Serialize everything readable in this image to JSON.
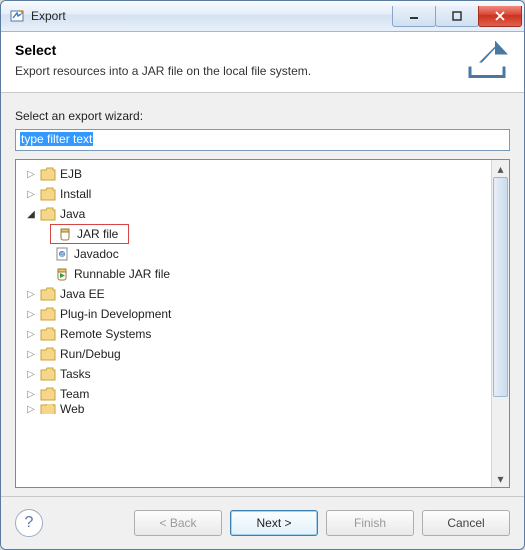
{
  "window": {
    "title": "Export"
  },
  "header": {
    "heading": "Select",
    "description": "Export resources into a JAR file on the local file system."
  },
  "body": {
    "label": "Select an export wizard:",
    "filter_placeholder": "type filter text",
    "filter_value": "type filter text"
  },
  "tree": {
    "nodes": [
      {
        "type": "folder",
        "state": "collapsed",
        "label": "EJB",
        "depth": 1
      },
      {
        "type": "folder",
        "state": "collapsed",
        "label": "Install",
        "depth": 1
      },
      {
        "type": "folder",
        "state": "expanded",
        "label": "Java",
        "depth": 1
      },
      {
        "type": "item",
        "icon": "jar",
        "label": "JAR file",
        "depth": 2,
        "highlighted": true
      },
      {
        "type": "item",
        "icon": "javadoc",
        "label": "Javadoc",
        "depth": 2
      },
      {
        "type": "item",
        "icon": "runjar",
        "label": "Runnable JAR file",
        "depth": 2
      },
      {
        "type": "folder",
        "state": "collapsed",
        "label": "Java EE",
        "depth": 1
      },
      {
        "type": "folder",
        "state": "collapsed",
        "label": "Plug-in Development",
        "depth": 1
      },
      {
        "type": "folder",
        "state": "collapsed",
        "label": "Remote Systems",
        "depth": 1
      },
      {
        "type": "folder",
        "state": "collapsed",
        "label": "Run/Debug",
        "depth": 1
      },
      {
        "type": "folder",
        "state": "collapsed",
        "label": "Tasks",
        "depth": 1
      },
      {
        "type": "folder",
        "state": "collapsed",
        "label": "Team",
        "depth": 1
      },
      {
        "type": "folder",
        "state": "collapsed",
        "label": "Web",
        "depth": 1,
        "cutoff": true
      }
    ]
  },
  "footer": {
    "back": "< Back",
    "next": "Next >",
    "finish": "Finish",
    "cancel": "Cancel"
  }
}
